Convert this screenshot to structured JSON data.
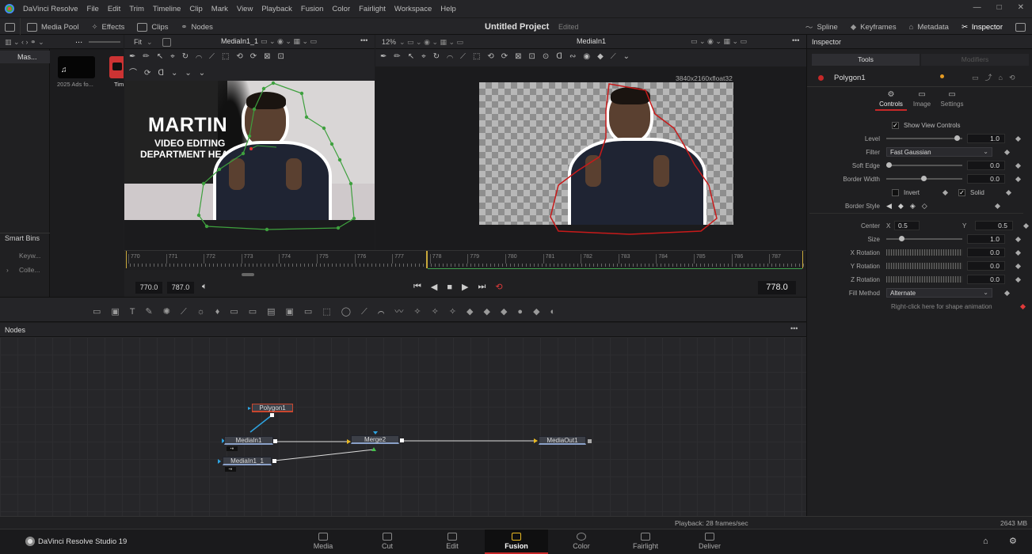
{
  "menubar": {
    "app": "DaVinci Resolve",
    "items": [
      "File",
      "Edit",
      "Trim",
      "Timeline",
      "Clip",
      "Mark",
      "View",
      "Playback",
      "Fusion",
      "Color",
      "Fairlight",
      "Workspace",
      "Help"
    ]
  },
  "toolbar": {
    "media_pool": "Media Pool",
    "effects": "Effects",
    "clips": "Clips",
    "nodes": "Nodes",
    "project": "Untitled Project",
    "edited": "Edited",
    "spline": "Spline",
    "keyframes": "Keyframes",
    "metadata": "Metadata",
    "inspector": "Inspector"
  },
  "mediapool": {
    "tab": "Mas...",
    "dots": "...",
    "clip1": "2025 Ads fo...",
    "clip2": "Tim",
    "smart_bins": "Smart Bins",
    "keyw": "Keyw...",
    "colle": "Colle..."
  },
  "viewer1": {
    "zoom": "Fit",
    "clip": "MediaIn1_1",
    "title_line1": "MARTIN",
    "title_line2": "VIDEO EDITING",
    "title_line3": "DEPARTMENT HEAD"
  },
  "viewer2": {
    "zoom": "12%",
    "clip": "MediaIn1",
    "resolution": "3840x2160xfloat32"
  },
  "timeline": {
    "ticks": [
      "770",
      "771",
      "772",
      "773",
      "774",
      "775",
      "776",
      "777",
      "778",
      "779",
      "780",
      "781",
      "782",
      "783",
      "784",
      "785",
      "786",
      "787"
    ],
    "in": "770.0",
    "out": "787.0",
    "current": "778.0"
  },
  "nodes": {
    "header": "Nodes",
    "polygon": "Polygon1",
    "mediain1": "MediaIn1",
    "mediain2": "MediaIn1_1",
    "merge": "Merge2",
    "mediaout": "MediaOut1",
    "status": "Playback: 28 frames/sec",
    "memory": "2643 MB"
  },
  "inspector": {
    "title": "Inspector",
    "tab_tools": "Tools",
    "tab_modifiers": "Modifiers",
    "node": "Polygon1",
    "subtabs": [
      "Controls",
      "Image",
      "Settings"
    ],
    "show_view_controls": "Show View Controls",
    "level_label": "Level",
    "level": "1.0",
    "filter_label": "Filter",
    "filter": "Fast Gaussian",
    "soft_edge_label": "Soft Edge",
    "soft_edge": "0.0",
    "border_width_label": "Border Width",
    "border_width": "0.0",
    "invert": "Invert",
    "solid": "Solid",
    "border_style_label": "Border Style",
    "center_label": "Center",
    "x_label": "X",
    "center_x": "0.5",
    "y_label": "Y",
    "center_y": "0.5",
    "size_label": "Size",
    "size": "1.0",
    "xrot_label": "X Rotation",
    "xrot": "0.0",
    "yrot_label": "Y Rotation",
    "yrot": "0.0",
    "zrot_label": "Z Rotation",
    "zrot": "0.0",
    "fill_label": "Fill Method",
    "fill": "Alternate",
    "hint": "Right-click here for shape animation"
  },
  "footer": {
    "brand": "DaVinci Resolve Studio 19",
    "pages": [
      "Media",
      "Cut",
      "Edit",
      "Fusion",
      "Color",
      "Fairlight",
      "Deliver"
    ],
    "active": "Fusion"
  }
}
